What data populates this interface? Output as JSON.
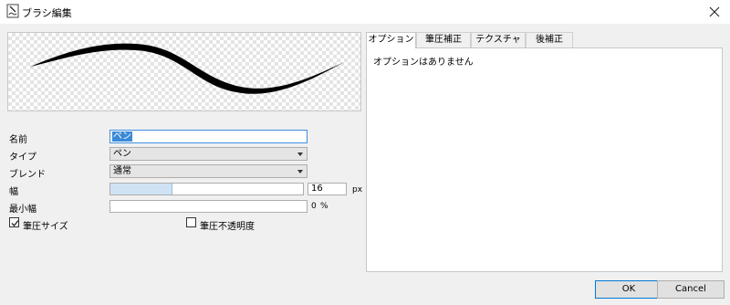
{
  "window": {
    "title": "ブラシ編集",
    "app_icon": "brush-icon",
    "close_icon": "close-icon"
  },
  "form": {
    "name_label": "名前",
    "name_value": "ペン",
    "type_label": "タイプ",
    "type_value": "ペン",
    "blend_label": "ブレンド",
    "blend_value": "通常",
    "width_label": "幅",
    "width_value": "16",
    "width_unit": "px",
    "width_fraction": 0.32,
    "min_width_label": "最小幅",
    "min_width_value": "0",
    "min_width_unit": "%",
    "pressure_size_label": "筆圧サイズ",
    "pressure_size_checked": true,
    "pressure_opacity_label": "筆圧不透明度",
    "pressure_opacity_checked": false
  },
  "tabs": [
    {
      "label": "オプション",
      "active": true
    },
    {
      "label": "筆圧補正",
      "active": false
    },
    {
      "label": "テクスチャ",
      "active": false
    },
    {
      "label": "後補正",
      "active": false
    }
  ],
  "panel": {
    "text": "オプションはありません"
  },
  "buttons": {
    "ok_label": "OK",
    "cancel_label": "Cancel"
  },
  "colors": {
    "accent": "#0078d7",
    "selection": "#3a89d6",
    "slider_fill": "#cfe3f4"
  }
}
